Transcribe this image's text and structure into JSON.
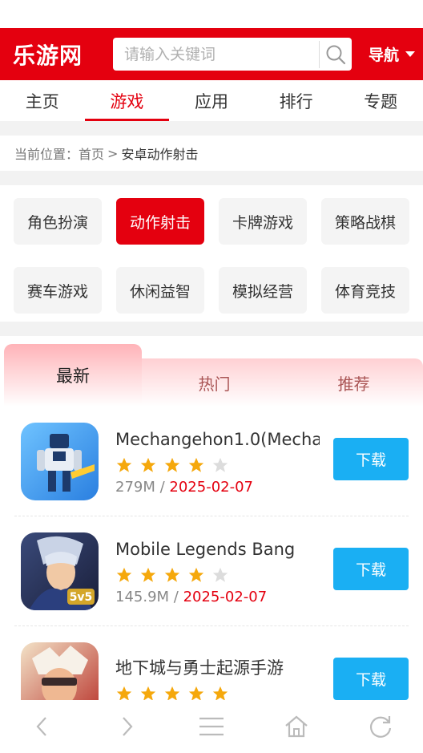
{
  "header": {
    "logo": "乐游网",
    "search_placeholder": "请输入关键词",
    "nav_label": "导航",
    "accent_color": "#e4000f"
  },
  "tabs": [
    {
      "label": "主页"
    },
    {
      "label": "游戏",
      "active": true
    },
    {
      "label": "应用"
    },
    {
      "label": "排行"
    },
    {
      "label": "专题"
    }
  ],
  "breadcrumb": {
    "prefix": "当前位置：",
    "home": "首页",
    "sep": ">",
    "current": "安卓动作射击"
  },
  "categories": [
    {
      "label": "角色扮演"
    },
    {
      "label": "动作射击",
      "active": true
    },
    {
      "label": "卡牌游戏"
    },
    {
      "label": "策略战棋"
    },
    {
      "label": "赛车游戏"
    },
    {
      "label": "休闲益智"
    },
    {
      "label": "模拟经营"
    },
    {
      "label": "体育竞技"
    }
  ],
  "list_tabs": [
    {
      "label": "最新",
      "active": true
    },
    {
      "label": "热门"
    },
    {
      "label": "推荐"
    }
  ],
  "apps": [
    {
      "name": "Mechangehon1.0(Mecha",
      "rating": 4,
      "size": "279M",
      "sep": " / ",
      "date": "2025-02-07",
      "download_label": "下载",
      "icon": "robot-game-icon"
    },
    {
      "name": "Mobile Legends Bang",
      "rating": 4,
      "size": "145.9M",
      "sep": " / ",
      "date": "2025-02-07",
      "download_label": "下载",
      "icon": "mobile-legends-icon"
    },
    {
      "name": "地下城与勇士起源手游",
      "rating": 5,
      "size": "",
      "sep": "",
      "date": "",
      "download_label": "下载",
      "icon": "dnf-game-icon"
    }
  ],
  "bottom_bar": [
    {
      "icon": "back-icon"
    },
    {
      "icon": "forward-icon"
    },
    {
      "icon": "menu-icon"
    },
    {
      "icon": "home-icon"
    },
    {
      "icon": "refresh-icon"
    }
  ]
}
